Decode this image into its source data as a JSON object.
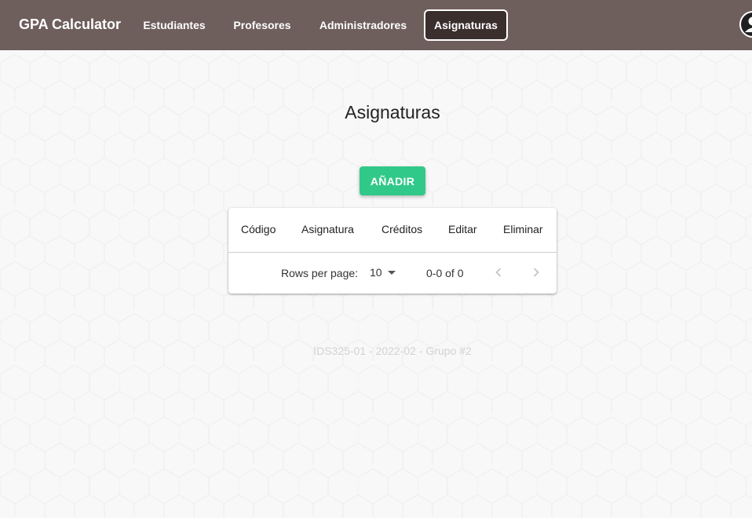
{
  "navbar": {
    "brand": "GPA Calculator",
    "items": [
      {
        "label": "Estudiantes"
      },
      {
        "label": "Profesores"
      },
      {
        "label": "Administradores"
      },
      {
        "label": "Asignaturas",
        "active": true
      }
    ]
  },
  "main": {
    "title": "Asignaturas",
    "add_button": "AÑADIR",
    "table": {
      "columns": [
        "Código",
        "Asignatura",
        "Créditos",
        "Editar",
        "Eliminar"
      ],
      "rows": []
    },
    "pagination": {
      "rows_per_page_label": "Rows per page:",
      "rows_per_page_value": "10",
      "range": "0-0 of 0"
    }
  },
  "footer": {
    "text": "IDS325-01 - 2022-02 - Grupo #2"
  },
  "icons": {
    "avatar": "user-avatar-icon",
    "prev": "chevron-left-icon",
    "next": "chevron-right-icon",
    "dropdown": "caret-down-icon"
  },
  "colors": {
    "navbar": "#6e5e5c",
    "active_nav": "#3b2f2e",
    "accent": "#31c98a",
    "background": "#f8f8f8"
  }
}
